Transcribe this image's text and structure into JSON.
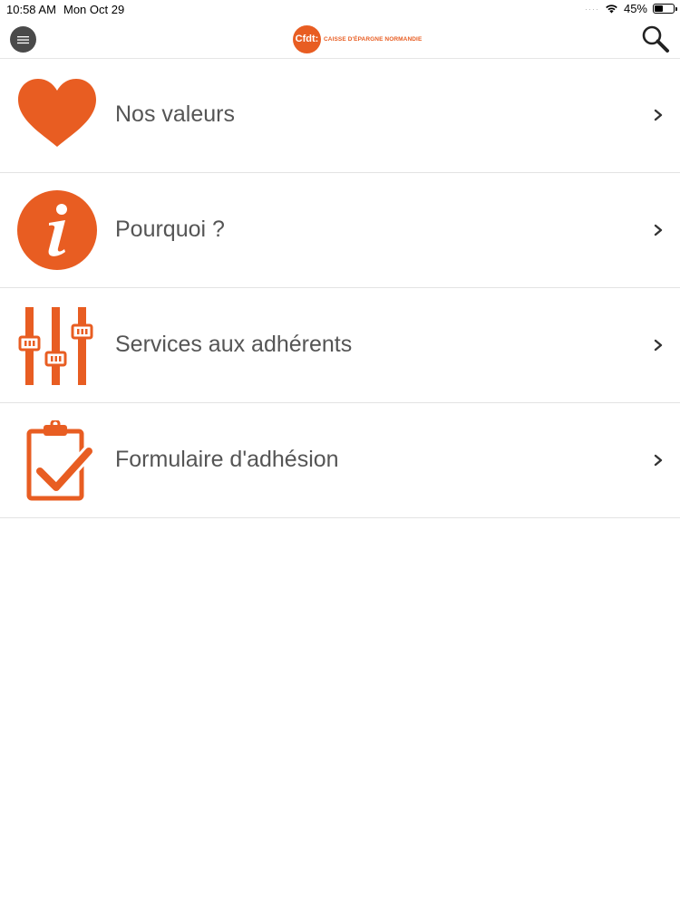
{
  "status_bar": {
    "time": "10:58 AM",
    "date": "Mon Oct 29",
    "signal": "····",
    "battery_percent": "45%",
    "battery_level": 0.45
  },
  "header": {
    "menu_icon": "hamburger-icon",
    "logo": {
      "mark": "Cfdt:",
      "text": "CAISSE D'ÉPARGNE NORMANDIE"
    },
    "search_icon": "magnifier-icon"
  },
  "colors": {
    "accent": "#e85d22",
    "text": "#555555",
    "divider": "#e3e3e3"
  },
  "menu_items": [
    {
      "label": "Nos valeurs",
      "icon": "heart-icon"
    },
    {
      "label": "Pourquoi ?",
      "icon": "info-icon"
    },
    {
      "label": "Services aux adhérents",
      "icon": "sliders-icon"
    },
    {
      "label": "Formulaire d'adhésion",
      "icon": "clipboard-check-icon"
    }
  ]
}
